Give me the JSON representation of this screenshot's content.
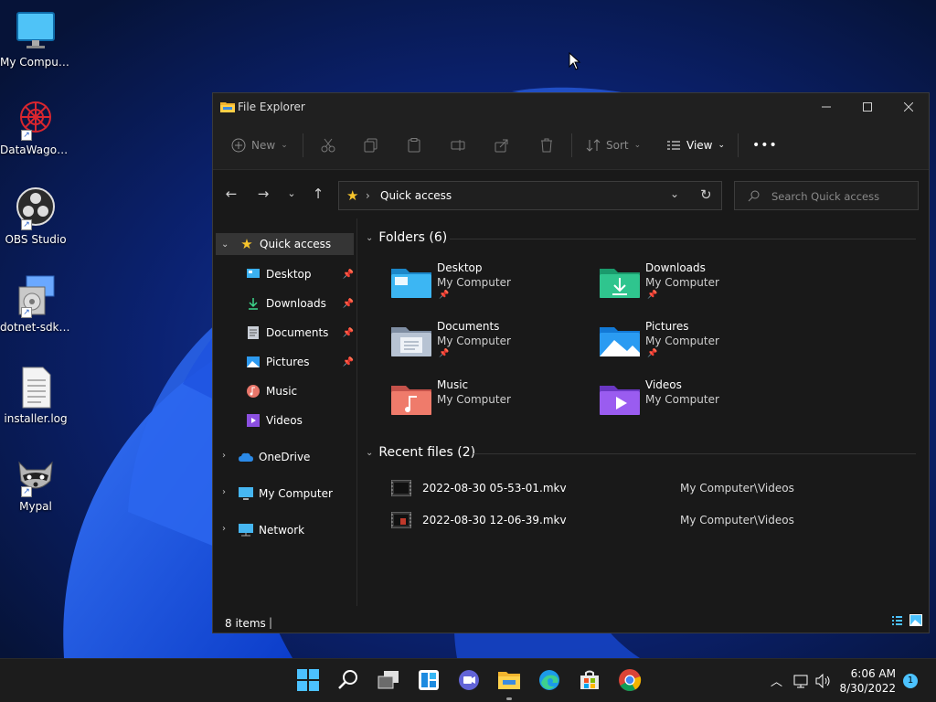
{
  "colors": {
    "accent": "#4cc2ff",
    "window_bg": "#191919",
    "title_bg": "#202020",
    "taskbar_bg": "#1c1c1c"
  },
  "desktop": {
    "icons": [
      {
        "label": "My Computer",
        "icon": "monitor-icon"
      },
      {
        "label": "DataWagon...",
        "icon": "datawagon-icon"
      },
      {
        "label": "OBS Studio",
        "icon": "obs-icon"
      },
      {
        "label": "dotnet-sdk-...",
        "icon": "installer-icon"
      },
      {
        "label": "installer.log",
        "icon": "text-file-icon"
      },
      {
        "label": "Mypal",
        "icon": "raccoon-icon"
      }
    ]
  },
  "window": {
    "title": "File Explorer",
    "commands": {
      "new": "New",
      "sort": "Sort",
      "view": "View",
      "more": "•••"
    },
    "address": {
      "crumb": "Quick access"
    },
    "search": {
      "placeholder": "Search Quick access"
    },
    "sidebar": {
      "quick_access": "Quick access",
      "items": [
        {
          "label": "Desktop",
          "pinned": true
        },
        {
          "label": "Downloads",
          "pinned": true
        },
        {
          "label": "Documents",
          "pinned": true
        },
        {
          "label": "Pictures",
          "pinned": true
        },
        {
          "label": "Music",
          "pinned": false
        },
        {
          "label": "Videos",
          "pinned": false
        }
      ],
      "onedrive": "OneDrive",
      "my_computer": "My Computer",
      "network": "Network"
    },
    "folders_header": "Folders (6)",
    "folders": [
      {
        "name": "Desktop",
        "location": "My Computer",
        "pinned": true
      },
      {
        "name": "Downloads",
        "location": "My Computer",
        "pinned": true
      },
      {
        "name": "Documents",
        "location": "My Computer",
        "pinned": true
      },
      {
        "name": "Pictures",
        "location": "My Computer",
        "pinned": true
      },
      {
        "name": "Music",
        "location": "My Computer",
        "pinned": false
      },
      {
        "name": "Videos",
        "location": "My Computer",
        "pinned": false
      }
    ],
    "recent_header": "Recent files (2)",
    "recent": [
      {
        "name": "2022-08-30 05-53-01.mkv",
        "location": "My Computer\\Videos"
      },
      {
        "name": "2022-08-30 12-06-39.mkv",
        "location": "My Computer\\Videos"
      }
    ],
    "status": {
      "count": "8 items",
      "divider": "|"
    }
  },
  "taskbar": {
    "time": "6:06 AM",
    "date": "8/30/2022",
    "notifications": "1"
  }
}
